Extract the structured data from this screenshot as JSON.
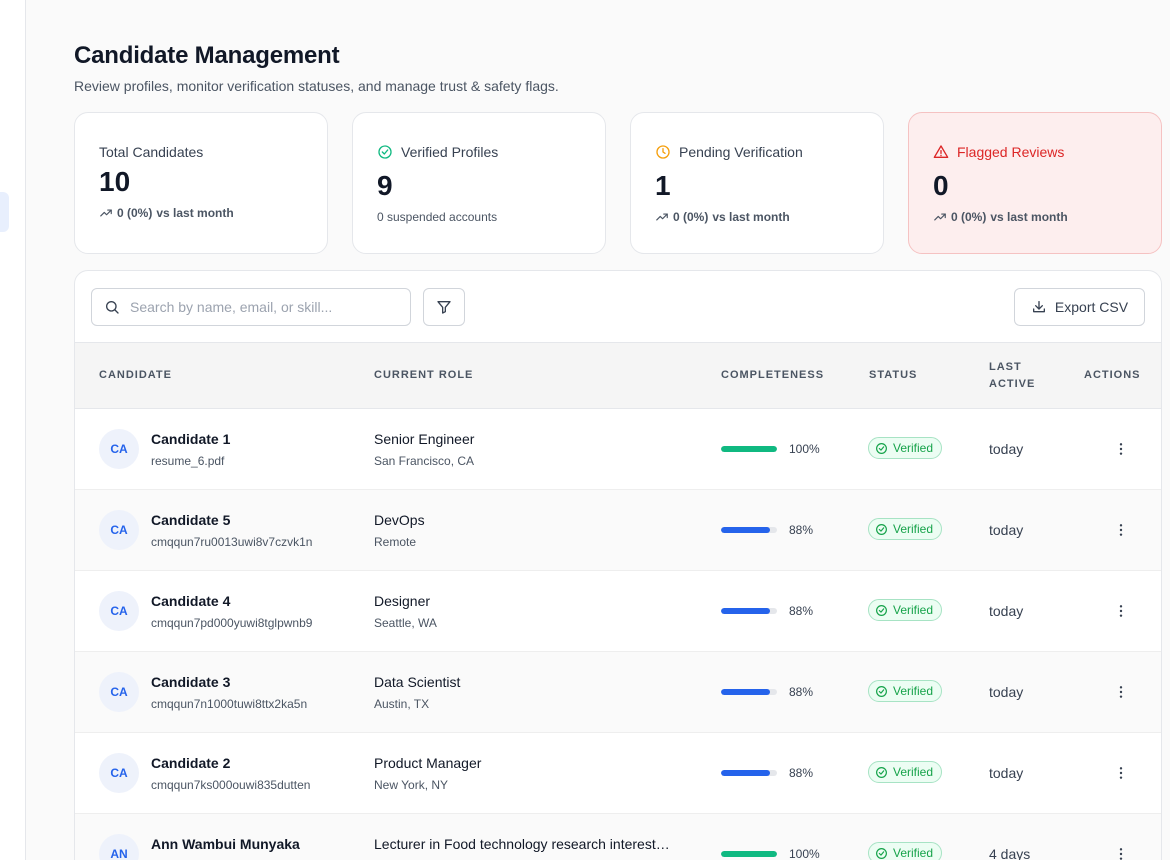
{
  "page": {
    "title": "Candidate Management",
    "subtitle": "Review profiles, monitor verification statuses, and manage trust & safety flags."
  },
  "stats": [
    {
      "label": "Total Candidates",
      "value": "10",
      "sub_bold": "0 (0%)",
      "sub_text": " vs last month",
      "icon": "none"
    },
    {
      "label": "Verified Profiles",
      "value": "9",
      "sub_bold": "",
      "sub_text": "0 suspended accounts",
      "icon": "check-circle-icon"
    },
    {
      "label": "Pending Verification",
      "value": "1",
      "sub_bold": "0 (0%)",
      "sub_text": " vs last month",
      "icon": "clock-icon"
    },
    {
      "label": "Flagged Reviews",
      "value": "0",
      "sub_bold": "0 (0%)",
      "sub_text": " vs last month",
      "icon": "alert-triangle-icon"
    }
  ],
  "toolbar": {
    "search_placeholder": "Search by name, email, or skill...",
    "search_value": "",
    "export_label": "Export CSV"
  },
  "table": {
    "headers": {
      "candidate": "CANDIDATE",
      "role": "CURRENT ROLE",
      "completeness": "COMPLETENESS",
      "status": "STATUS",
      "last_active_line1": "LAST",
      "last_active_line2": "ACTIVE",
      "actions": "ACTIONS"
    },
    "rows": [
      {
        "initials": "CA",
        "name": "Candidate 1",
        "sub": "resume_6.pdf",
        "role": "Senior Engineer",
        "location": "San Francisco, CA",
        "completeness": 100,
        "completeness_label": "100%",
        "status": "Verified",
        "last_active": "today"
      },
      {
        "initials": "CA",
        "name": "Candidate 5",
        "sub": "cmqqun7ru0013uwi8v7czvk1n",
        "role": "DevOps",
        "location": "Remote",
        "completeness": 88,
        "completeness_label": "88%",
        "status": "Verified",
        "last_active": "today"
      },
      {
        "initials": "CA",
        "name": "Candidate 4",
        "sub": "cmqqun7pd000yuwi8tglpwnb9",
        "role": "Designer",
        "location": "Seattle, WA",
        "completeness": 88,
        "completeness_label": "88%",
        "status": "Verified",
        "last_active": "today"
      },
      {
        "initials": "CA",
        "name": "Candidate 3",
        "sub": "cmqqun7n1000tuwi8ttx2ka5n",
        "role": "Data Scientist",
        "location": "Austin, TX",
        "completeness": 88,
        "completeness_label": "88%",
        "status": "Verified",
        "last_active": "today"
      },
      {
        "initials": "CA",
        "name": "Candidate 2",
        "sub": "cmqqun7ks000ouwi835dutten",
        "role": "Product Manager",
        "location": "New York, NY",
        "completeness": 88,
        "completeness_label": "88%",
        "status": "Verified",
        "last_active": "today"
      },
      {
        "initials": "AN",
        "name": "Ann Wambui Munyaka",
        "sub": "",
        "role": "Lecturer in Food technology research interest…",
        "location": "",
        "completeness": 100,
        "completeness_label": "100%",
        "status": "Verified",
        "last_active": "4 days"
      }
    ]
  },
  "colors": {
    "accent_blue": "#2563eb",
    "complete_green": "#10b981",
    "verified_green": "#16a34a",
    "flag_red": "#dc2626",
    "pending_amber": "#f59e0b"
  }
}
